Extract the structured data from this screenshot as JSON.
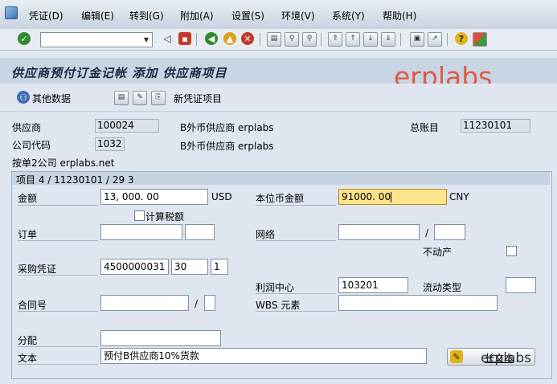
{
  "menu": {
    "items": [
      "凭证(D)",
      "编辑(E)",
      "转到(G)",
      "附加(A)",
      "设置(S)",
      "环境(V)",
      "系统(Y)",
      "帮助(H)"
    ]
  },
  "toolbar": {
    "command_value": ""
  },
  "title": "供应商预付订金记帐 添加 供应商项目",
  "watermark": "erplabs",
  "app_toolbar": {
    "other_data": "其他数据",
    "new_document_item": "新凭证项目"
  },
  "header": {
    "vendor_label": "供应商",
    "vendor_value": "100024",
    "vendor_name": "B外币供应商 erplabs",
    "gl_label": "总账目",
    "gl_value": "11230101",
    "company_label": "公司代码",
    "company_value": "1032",
    "company_name": "B外币供应商 erplabs",
    "company_desc": "按单2公司 erplabs.net"
  },
  "item": {
    "group_title": "项目 4 / 11230101 / 29 3",
    "amount_label": "金额",
    "amount_value": "13, 000. 00",
    "amount_currency": "USD",
    "local_amount_label": "本位币金额",
    "local_amount_value": "91000. 00",
    "local_currency": "CNY",
    "calc_tax_label": "计算税额",
    "order_label": "订单",
    "order_value": "",
    "order_item": "",
    "network_label": "网络",
    "network_value": "",
    "network_sep": "/",
    "network_op": "",
    "real_estate_label": "不动产",
    "po_label": "采购凭证",
    "po_value": "4500000031",
    "po_item": "30",
    "po_sched": "1",
    "profit_center_label": "利润中心",
    "profit_center_value": "103201",
    "flow_type_label": "流动类型",
    "flow_type_value": "",
    "contract_label": "合同号",
    "contract_value": "",
    "contract_sep": "/",
    "contract_type": "",
    "wbs_label": "WBS 元素",
    "wbs_value": "",
    "assignment_label": "分配",
    "assignment_value": "",
    "text_label": "文本",
    "text_value": "预付B供应商10%货款",
    "long_text_button": "长文本",
    "long_text_overlay": "erplabs"
  },
  "colors": {
    "highlight": "#fbe48a",
    "watermark": "#e05a45"
  }
}
